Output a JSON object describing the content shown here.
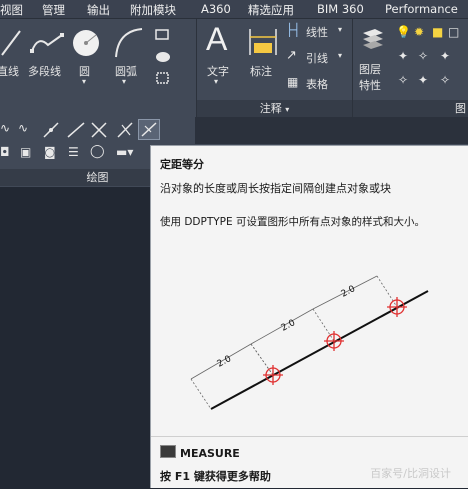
{
  "menu": {
    "items": [
      "视图",
      "管理",
      "输出",
      "附加模块",
      "A360",
      "精选应用",
      "BIM 360",
      "Performance"
    ]
  },
  "ribbon": {
    "draw_tools": [
      "直线",
      "多段线",
      "圆",
      "圆弧"
    ],
    "annotation_tools": {
      "text": "文字",
      "dimension": "标注",
      "linear": "线性",
      "leader": "引线",
      "table": "表格"
    },
    "layer_props": [
      "图层",
      "特性"
    ],
    "annotation_panel_label": "注释",
    "draw_panel_label": "绘图",
    "layer_panel_label": "图"
  },
  "tooltip": {
    "title": "定距等分",
    "description": "沿对象的长度或周长按指定间隔创建点对象或块",
    "note": "使用 DDPTYPE 可设置图形中所有点对象的样式和大小。",
    "diagram_labels": [
      "2.0",
      "2.0",
      "2.0"
    ],
    "command": "MEASURE",
    "help": "按 F1 键获得更多帮助"
  },
  "watermark": "百家号/比洞设计",
  "colors": {
    "menubar": "#3b4250",
    "ribbon": "#414957",
    "drawing_area": "#222833",
    "tooltip_bg": "#f4f4f4",
    "marker_red": "#e03030"
  }
}
